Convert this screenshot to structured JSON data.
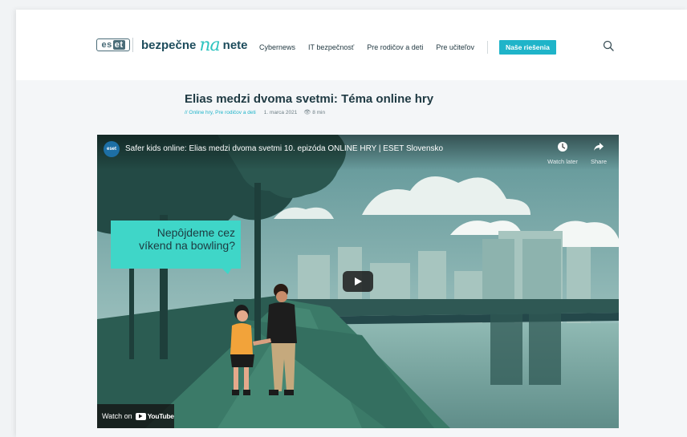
{
  "header": {
    "logo_eset_left": "es",
    "logo_eset_right": "et",
    "brand": {
      "word1": "bezpečne",
      "word2": "na",
      "word3": "nete"
    },
    "nav": [
      "Cybernews",
      "IT bezpečnosť",
      "Pre rodičov a deti",
      "Pre učiteľov"
    ],
    "cta_label": "Naše riešenia",
    "icons": {
      "search": "search-icon"
    },
    "colors": {
      "accent": "#1fb4c9",
      "brand_dark": "#1d4c5c",
      "brand_light": "#2ec4c0"
    }
  },
  "article": {
    "title": "Elias medzi dvoma svetmi: Téma online hry",
    "categories": "// Online hry, Pre rodičov a deti",
    "date": "1. marca 2021",
    "read_time": "8 min",
    "icons": {
      "read_time": "eye-icon"
    }
  },
  "video": {
    "channel_avatar": "eset",
    "title": "Safer kids online: Elias medzi dvoma svetmi 10. epizóda ONLINE HRY | ESET Slovensko",
    "watch_later": "Watch later",
    "share": "Share",
    "bubble_line1": "Nepôjdeme cez",
    "bubble_line2": "víkend na bowling?",
    "watch_on": "Watch on",
    "youtube": "YouTube",
    "icons": {
      "play": "play-icon",
      "watch_later": "clock-icon",
      "share": "share-arrow-icon"
    }
  }
}
